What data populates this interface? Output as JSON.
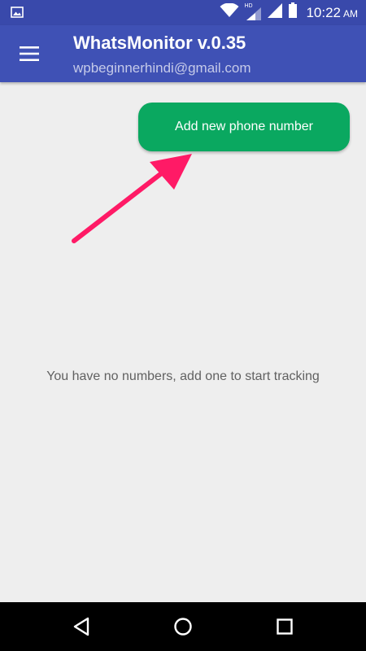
{
  "status_bar": {
    "time": "10:22",
    "ampm": "AM",
    "network_badge": "HD",
    "icons": [
      "gallery-icon",
      "wifi-icon",
      "signal-hd-icon",
      "signal-icon",
      "battery-icon"
    ]
  },
  "app_bar": {
    "title": "WhatsMonitor v.0.35",
    "subtitle": "wpbeginnerhindi@gmail.com",
    "menu_icon": "hamburger-menu-icon",
    "color": "#3f51b5"
  },
  "main": {
    "add_button_label": "Add new phone number",
    "add_button_color": "#0aa860",
    "empty_message": "You have no numbers, add one to start tracking",
    "annotation_arrow_color": "#ff1a66"
  },
  "nav_bar": {
    "buttons": [
      "back-icon",
      "home-icon",
      "recents-icon"
    ]
  }
}
